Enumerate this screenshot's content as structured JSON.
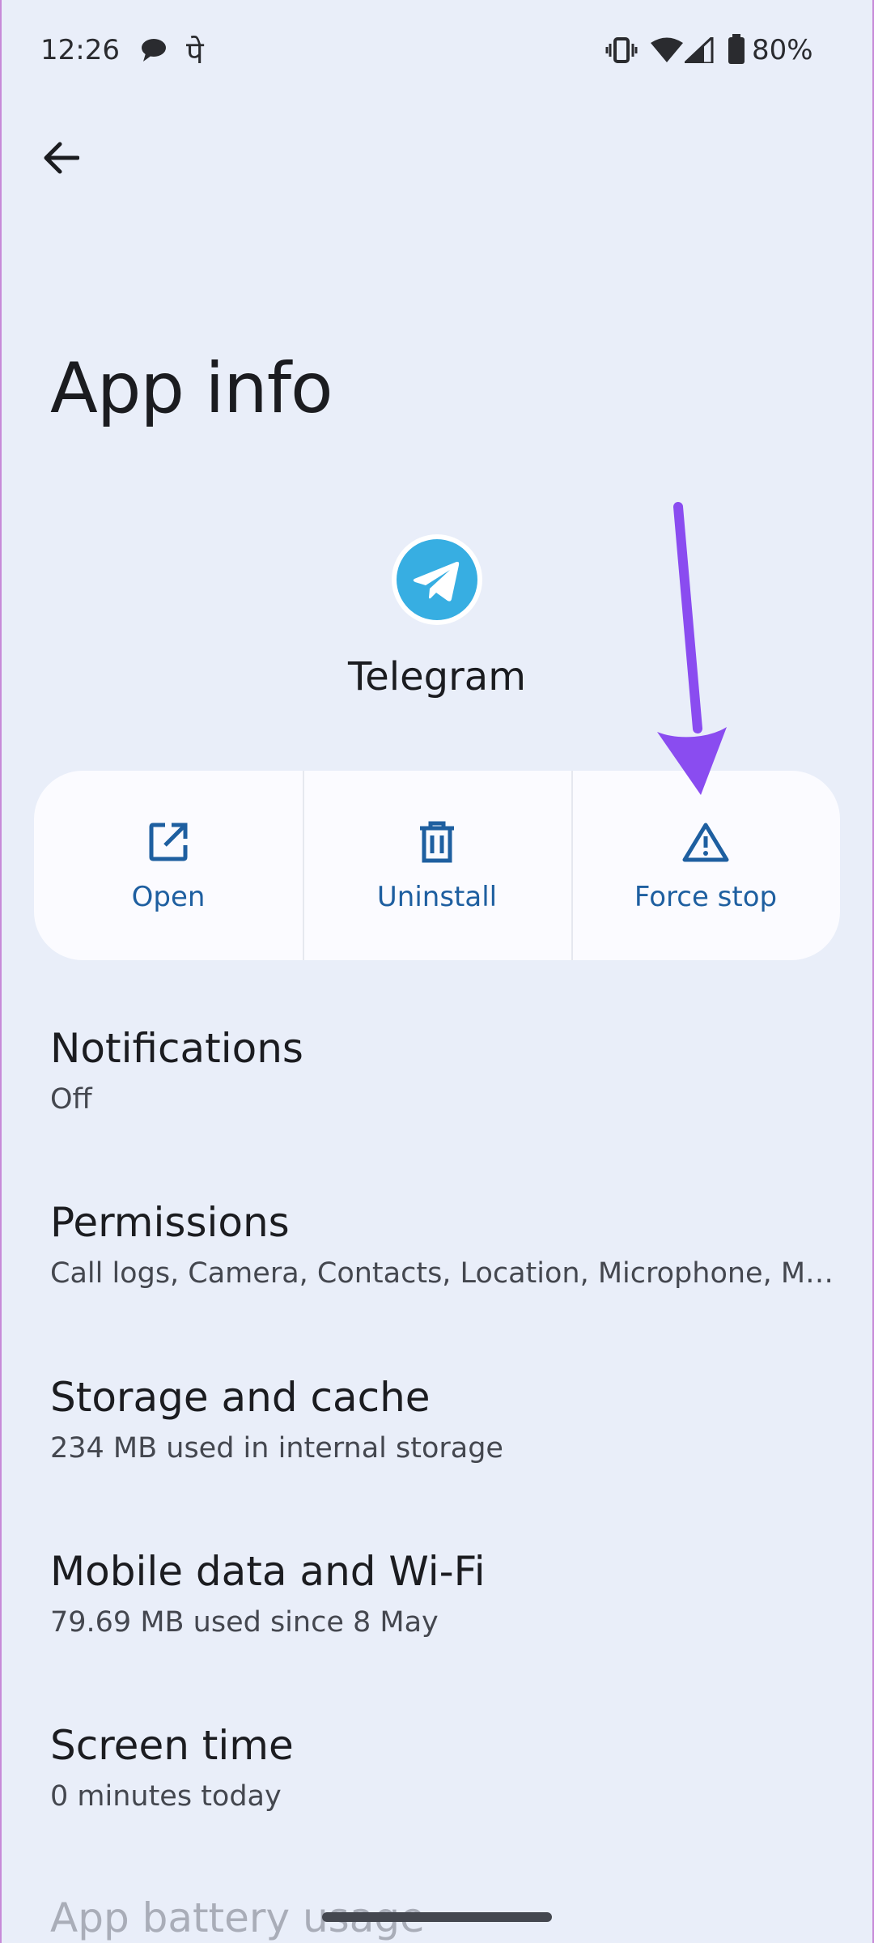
{
  "status_bar": {
    "time": "12:26",
    "hindi_glyph": "पे",
    "battery": "80%",
    "icons": [
      "chat-icon",
      "vibrate-icon",
      "wifi-icon",
      "signal-icon",
      "battery-icon"
    ]
  },
  "header": {
    "back_icon": "arrow-left-icon",
    "title": "App info"
  },
  "app": {
    "name": "Telegram",
    "icon": "telegram-icon",
    "brand_color": "#37aee2"
  },
  "actions": [
    {
      "label": "Open",
      "icon": "open-external-icon"
    },
    {
      "label": "Uninstall",
      "icon": "trash-icon"
    },
    {
      "label": "Force stop",
      "icon": "warning-triangle-icon"
    }
  ],
  "settings": [
    {
      "title": "Notifications",
      "subtitle": "Off"
    },
    {
      "title": "Permissions",
      "subtitle": "Call logs, Camera, Contacts, Location, Microphone, Music and audio, Nearby devices, Phone, Photos and videos"
    },
    {
      "title": "Storage and cache",
      "subtitle": "234 MB used in internal storage"
    },
    {
      "title": "Mobile data and Wi-Fi",
      "subtitle": "79.69 MB used since 8 May"
    },
    {
      "title": "Screen time",
      "subtitle": "0 minutes today"
    },
    {
      "title": "App battery usage"
    }
  ],
  "colors": {
    "background": "#e9eef9",
    "action_text": "#1e5fa0",
    "annotation_arrow": "#8a4cf0"
  }
}
